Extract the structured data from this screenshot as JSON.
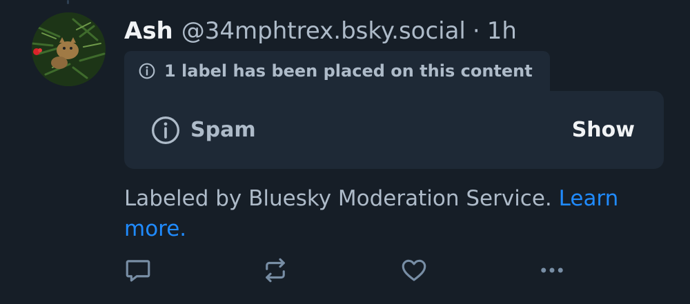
{
  "post": {
    "author_name": "Ash",
    "author_handle": "@34mphtrex.bsky.social",
    "separator": "·",
    "time": "1h",
    "avatar_icon": "cat-in-tree-avatar"
  },
  "moderation": {
    "label_notice": "1 label has been placed on this content",
    "label_name": "Spam",
    "show_label": "Show",
    "labeled_by_text": "Labeled by Bluesky Moderation Service. ",
    "learn_more": "Learn more."
  },
  "actions": {
    "reply_icon": "reply-icon",
    "repost_icon": "repost-icon",
    "like_icon": "heart-icon",
    "more_icon": "more-icon"
  },
  "colors": {
    "background": "#161e27",
    "card": "#1e2936",
    "muted_text": "#aebbc9",
    "link": "#208bfe",
    "icon": "#788ea5"
  }
}
